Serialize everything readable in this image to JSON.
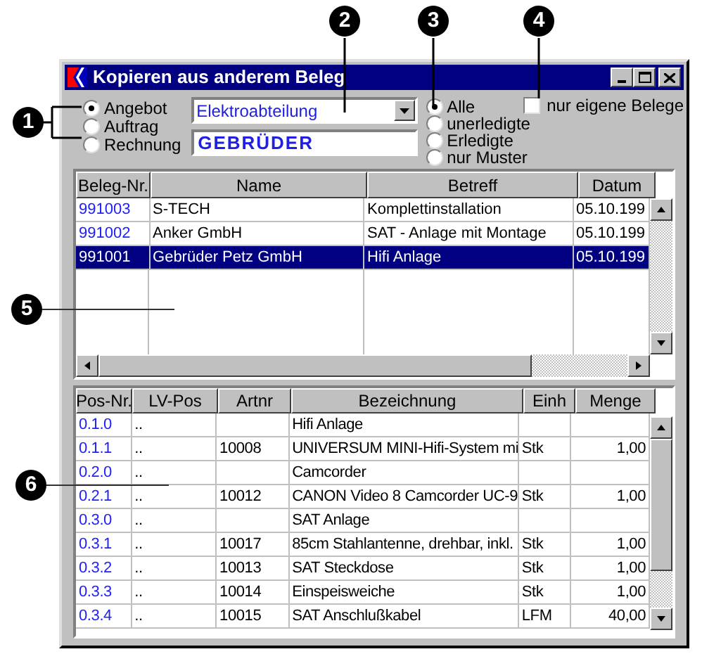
{
  "window": {
    "title": "Kopieren aus anderem Beleg"
  },
  "document_types": [
    {
      "label": "Angebot",
      "selected": true
    },
    {
      "label": "Auftrag",
      "selected": false
    },
    {
      "label": "Rechnung",
      "selected": false
    }
  ],
  "department_dropdown": {
    "value": "Elektroabteilung"
  },
  "search_field": {
    "value": "GEBRÜDER"
  },
  "status_filters": [
    {
      "label": "Alle",
      "selected": true
    },
    {
      "label": "unerledigte",
      "selected": false
    },
    {
      "label": "Erledigte",
      "selected": false
    },
    {
      "label": "nur Muster",
      "selected": false
    }
  ],
  "own_documents_checkbox": {
    "label": "nur eigene Belege",
    "checked": false
  },
  "documents_table": {
    "columns": [
      "Beleg-Nr.",
      "Name",
      "Betreff",
      "Datum"
    ],
    "rows": [
      {
        "cells": [
          "991003",
          "S-TECH",
          "Komplettinstallation",
          "05.10.199"
        ],
        "selected": false
      },
      {
        "cells": [
          "991002",
          "Anker GmbH",
          "SAT - Anlage mit Montage",
          "05.10.199"
        ],
        "selected": false
      },
      {
        "cells": [
          "991001",
          "Gebrüder Petz GmbH",
          "Hifi Anlage",
          "05.10.199"
        ],
        "selected": true
      }
    ]
  },
  "positions_table": {
    "columns": [
      "Pos-Nr.",
      "LV-Pos",
      "Artnr",
      "Bezeichnung",
      "Einh",
      "Menge"
    ],
    "rows": [
      [
        "0.1.0",
        "..",
        "",
        "Hifi Anlage",
        "",
        ""
      ],
      [
        "0.1.1",
        "..",
        "10008",
        "UNIVERSUM MINI-Hifi-System mi",
        "Stk",
        "1,00"
      ],
      [
        "0.2.0",
        "..",
        "",
        "Camcorder",
        "",
        ""
      ],
      [
        "0.2.1",
        "..",
        "10012",
        "CANON Video 8 Camcorder UC-9",
        "Stk",
        "1,00"
      ],
      [
        "0.3.0",
        "..",
        "",
        "SAT Anlage",
        "",
        ""
      ],
      [
        "0.3.1",
        "..",
        "10017",
        "85cm Stahlantenne, drehbar, inkl.",
        "Stk",
        "1,00"
      ],
      [
        "0.3.2",
        "..",
        "10013",
        "SAT Steckdose",
        "Stk",
        "1,00"
      ],
      [
        "0.3.3",
        "..",
        "10014",
        "Einspeisweiche",
        "Stk",
        "1,00"
      ],
      [
        "0.3.4",
        "..",
        "10015",
        "SAT Anschlußkabel",
        "LFM",
        "40,00"
      ]
    ]
  },
  "callouts": [
    "1",
    "2",
    "3",
    "4",
    "5",
    "6"
  ]
}
